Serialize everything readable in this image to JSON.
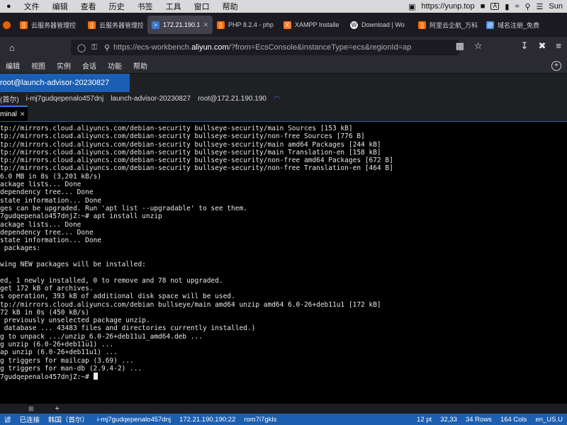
{
  "menubar": {
    "items": [
      "文件",
      "编辑",
      "查看",
      "历史",
      "书签",
      "工具",
      "窗口",
      "帮助"
    ],
    "right_url": "https://yunp.top",
    "right_a": "A",
    "right_user": "Sun"
  },
  "tabs": [
    {
      "label": "云服务器管理控",
      "icon": "cloud-icon",
      "color": "#ff6a00",
      "active": false
    },
    {
      "label": "云服务器管理控",
      "icon": "cloud-icon",
      "color": "#ff6a00",
      "active": false
    },
    {
      "label": "172.21.190.19",
      "icon": "terminal-icon",
      "color": "#3a78c9",
      "active": true
    },
    {
      "label": "PHP 8.2.4 - php",
      "icon": "php-icon",
      "color": "#ff6a00",
      "active": false
    },
    {
      "label": "XAMPP Installe",
      "icon": "xampp-icon",
      "color": "#fb7a24",
      "active": false
    },
    {
      "label": "Download | Wo",
      "icon": "wordpress-icon",
      "color": "#eeeeee",
      "active": false
    },
    {
      "label": "阿里云企航_万科",
      "icon": "cloud-icon",
      "color": "#ff6a00",
      "active": false
    },
    {
      "label": "域名注册_免费",
      "icon": "domain-icon",
      "color": "#4a90e2",
      "active": false
    }
  ],
  "url": {
    "prefix": "https://ecs-workbench.",
    "host": "aliyun.com",
    "rest": "/?from=EcsConsole&instanceType=ecs&regionId=ap"
  },
  "appmenu": [
    "编辑",
    "视图",
    "实例",
    "会话",
    "功能",
    "帮助"
  ],
  "host_tab": "root@launch-advisor-20230827",
  "infobar": [
    "(首尔)",
    "i-mj7gudqepenalo457dnj",
    "launch-advisor-20230827",
    "root@172.21.190.190"
  ],
  "terminal_tab": "minal",
  "terminal_lines": [
    "tp://mirrors.cloud.aliyuncs.com/debian-security bullseye-security/main Sources [153 kB]",
    "tp://mirrors.cloud.aliyuncs.com/debian-security bullseye-security/non-free Sources [776 B]",
    "tp://mirrors.cloud.aliyuncs.com/debian-security bullseye-security/main amd64 Packages [244 kB]",
    "tp://mirrors.cloud.aliyuncs.com/debian-security bullseye-security/main Translation-en [158 kB]",
    "tp://mirrors.cloud.aliyuncs.com/debian-security bullseye-security/non-free amd64 Packages [672 B]",
    "tp://mirrors.cloud.aliyuncs.com/debian-security bullseye-security/non-free Translation-en [464 B]",
    "6.0 MB in 8s (3,201 kB/s)",
    "ackage lists... Done",
    "dependency tree... Done",
    "state information... Done",
    "ges can be upgraded. Run 'apt list --upgradable' to see them.",
    "7gudqepenalo457dnjZ:~# apt install unzip",
    "ackage lists... Done",
    "dependency tree... Done",
    "state information... Done",
    " packages:",
    "",
    "wing NEW packages will be installed:",
    "",
    "ed, 1 newly installed, 0 to remove and 78 not upgraded.",
    "get 172 kB of archives.",
    "s operation, 393 kB of additional disk space will be used.",
    "tp://mirrors.cloud.aliyuncs.com/debian bullseye/main amd64 unzip amd64 6.0-26+deb11u1 [172 kB]",
    "72 kB in 0s (450 kB/s)",
    " previously unselected package unzip.",
    " database ... 43483 files and directories currently installed.)",
    "g to unpack .../unzip_6.0-26+deb11u1_amd64.deb ...",
    "g unzip (6.0-26+deb11u1) ...",
    "ap unzip (6.0-26+deb11u1) ...",
    "g triggers for mailcap (3.69) ...",
    "g triggers for man-db (2.9.4-2) ...",
    "7gudqepenalo457dnjZ:~# "
  ],
  "statusbar": {
    "left": [
      "谚",
      "已连接",
      "韩国（首尔）",
      "i-mj7gudqepenalo457dnj",
      "172.21.190.190:22",
      "rom7i7gkls"
    ],
    "right": [
      "12 pt",
      "32,33",
      "34 Rows",
      "164 Cols",
      "en_US.U"
    ]
  }
}
